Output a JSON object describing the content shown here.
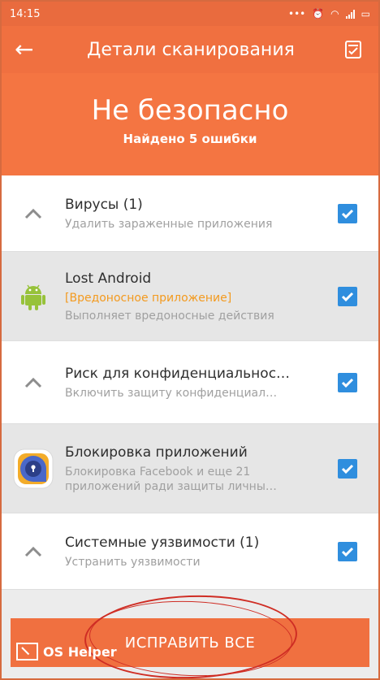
{
  "status_bar": {
    "time": "14:15"
  },
  "app_bar": {
    "title": "Детали сканирования"
  },
  "summary": {
    "title": "Не безопасно",
    "subtitle": "Найдено 5 ошибки"
  },
  "items": [
    {
      "name": "Вирусы (1)",
      "desc": "Удалить зараженные приложения",
      "checked": true
    },
    {
      "name": "Lost Android",
      "tag": "[Вредоносное приложение]",
      "desc": "Выполняет вредоносные действия",
      "checked": true
    },
    {
      "name": "Риск для конфиденциальнос…",
      "desc": "Включить защиту конфиденциал…",
      "checked": true
    },
    {
      "name": "Блокировка приложений",
      "desc": "Блокировка Facebook и еще 21",
      "desc2": "приложений ради защиты личны…",
      "checked": true
    },
    {
      "name": "Системные уязвимости (1)",
      "desc": "Устранить уязвимости",
      "checked": true
    }
  ],
  "footer": {
    "fix_all_label": "ИСПРАВИТЬ ВСЕ"
  },
  "watermark": {
    "text": "OS Helper"
  },
  "colors": {
    "accent": "#f07040",
    "checkbox": "#2f8ede",
    "warning": "#f39a1f"
  }
}
